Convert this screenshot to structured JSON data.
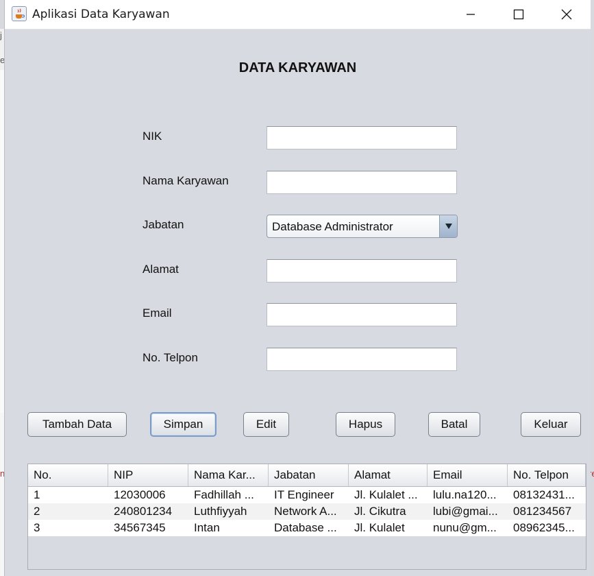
{
  "window": {
    "title": "Aplikasi Data Karyawan",
    "icon": "java-cup-icon"
  },
  "background_app": {
    "chars": [
      "j",
      "e",
      "n",
      "re"
    ]
  },
  "form": {
    "heading": "DATA KARYAWAN",
    "fields": [
      {
        "label": "NIK",
        "value": ""
      },
      {
        "label": "Nama Karyawan",
        "value": ""
      },
      {
        "label": "Jabatan",
        "value": "Database Administrator"
      },
      {
        "label": "Alamat",
        "value": ""
      },
      {
        "label": "Email",
        "value": ""
      },
      {
        "label": "No. Telpon",
        "value": ""
      }
    ]
  },
  "buttons": {
    "tambah": "Tambah Data",
    "simpan": "Simpan",
    "edit": "Edit",
    "hapus": "Hapus",
    "batal": "Batal",
    "keluar": "Keluar"
  },
  "table": {
    "columns": [
      "No.",
      "NIP",
      "Nama Kar...",
      "Jabatan",
      "Alamat",
      "Email",
      "No. Telpon"
    ],
    "rows": [
      [
        "1",
        "12030006",
        "Fadhillah ...",
        "IT Engineer",
        "Jl. Kulalet ...",
        "lulu.na120...",
        "08132431..."
      ],
      [
        "2",
        "240801234",
        "Luthfiyyah",
        "Network A...",
        "Jl. Cikutra",
        "lubi@gmai...",
        "081234567"
      ],
      [
        "3",
        "34567345",
        "Intan",
        "Database ...",
        "Jl. Kulalet",
        "nunu@gm...",
        "08962345..."
      ]
    ]
  },
  "colors": {
    "window_bg": "#d8dae1",
    "focus_border": "#7b9cc4",
    "combo_arrow": "#9fb3cc"
  }
}
